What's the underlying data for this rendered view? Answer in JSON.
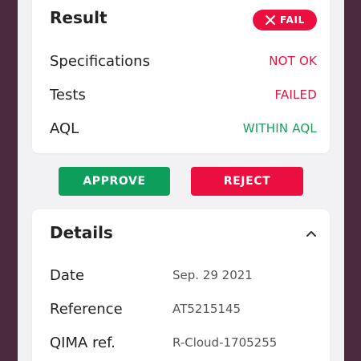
{
  "result": {
    "title": "Result",
    "badge": {
      "label": "FAIL",
      "icon": "close-icon",
      "color": "#ea0f3f"
    },
    "rows": [
      {
        "label": "Specifications",
        "value": "NOT OK",
        "status": "red"
      },
      {
        "label": "Tests",
        "value": "FAILED",
        "status": "red"
      },
      {
        "label": "AQL",
        "value": "WITHIN AQL",
        "status": "green"
      }
    ]
  },
  "actions": {
    "approve_label": "APPROVE",
    "reject_label": "REJECT",
    "approve_color": "#0d9e5c",
    "reject_color": "#ea0f3f"
  },
  "details": {
    "title": "Details",
    "toggle_icon": "chevron-up-icon",
    "rows": [
      {
        "label": "Date",
        "value": "Sep. 29 2021"
      },
      {
        "label": "Reference",
        "value": "AT5215145"
      },
      {
        "label": "QIMA ref.",
        "value": "R-Cloud-1705255"
      }
    ]
  }
}
